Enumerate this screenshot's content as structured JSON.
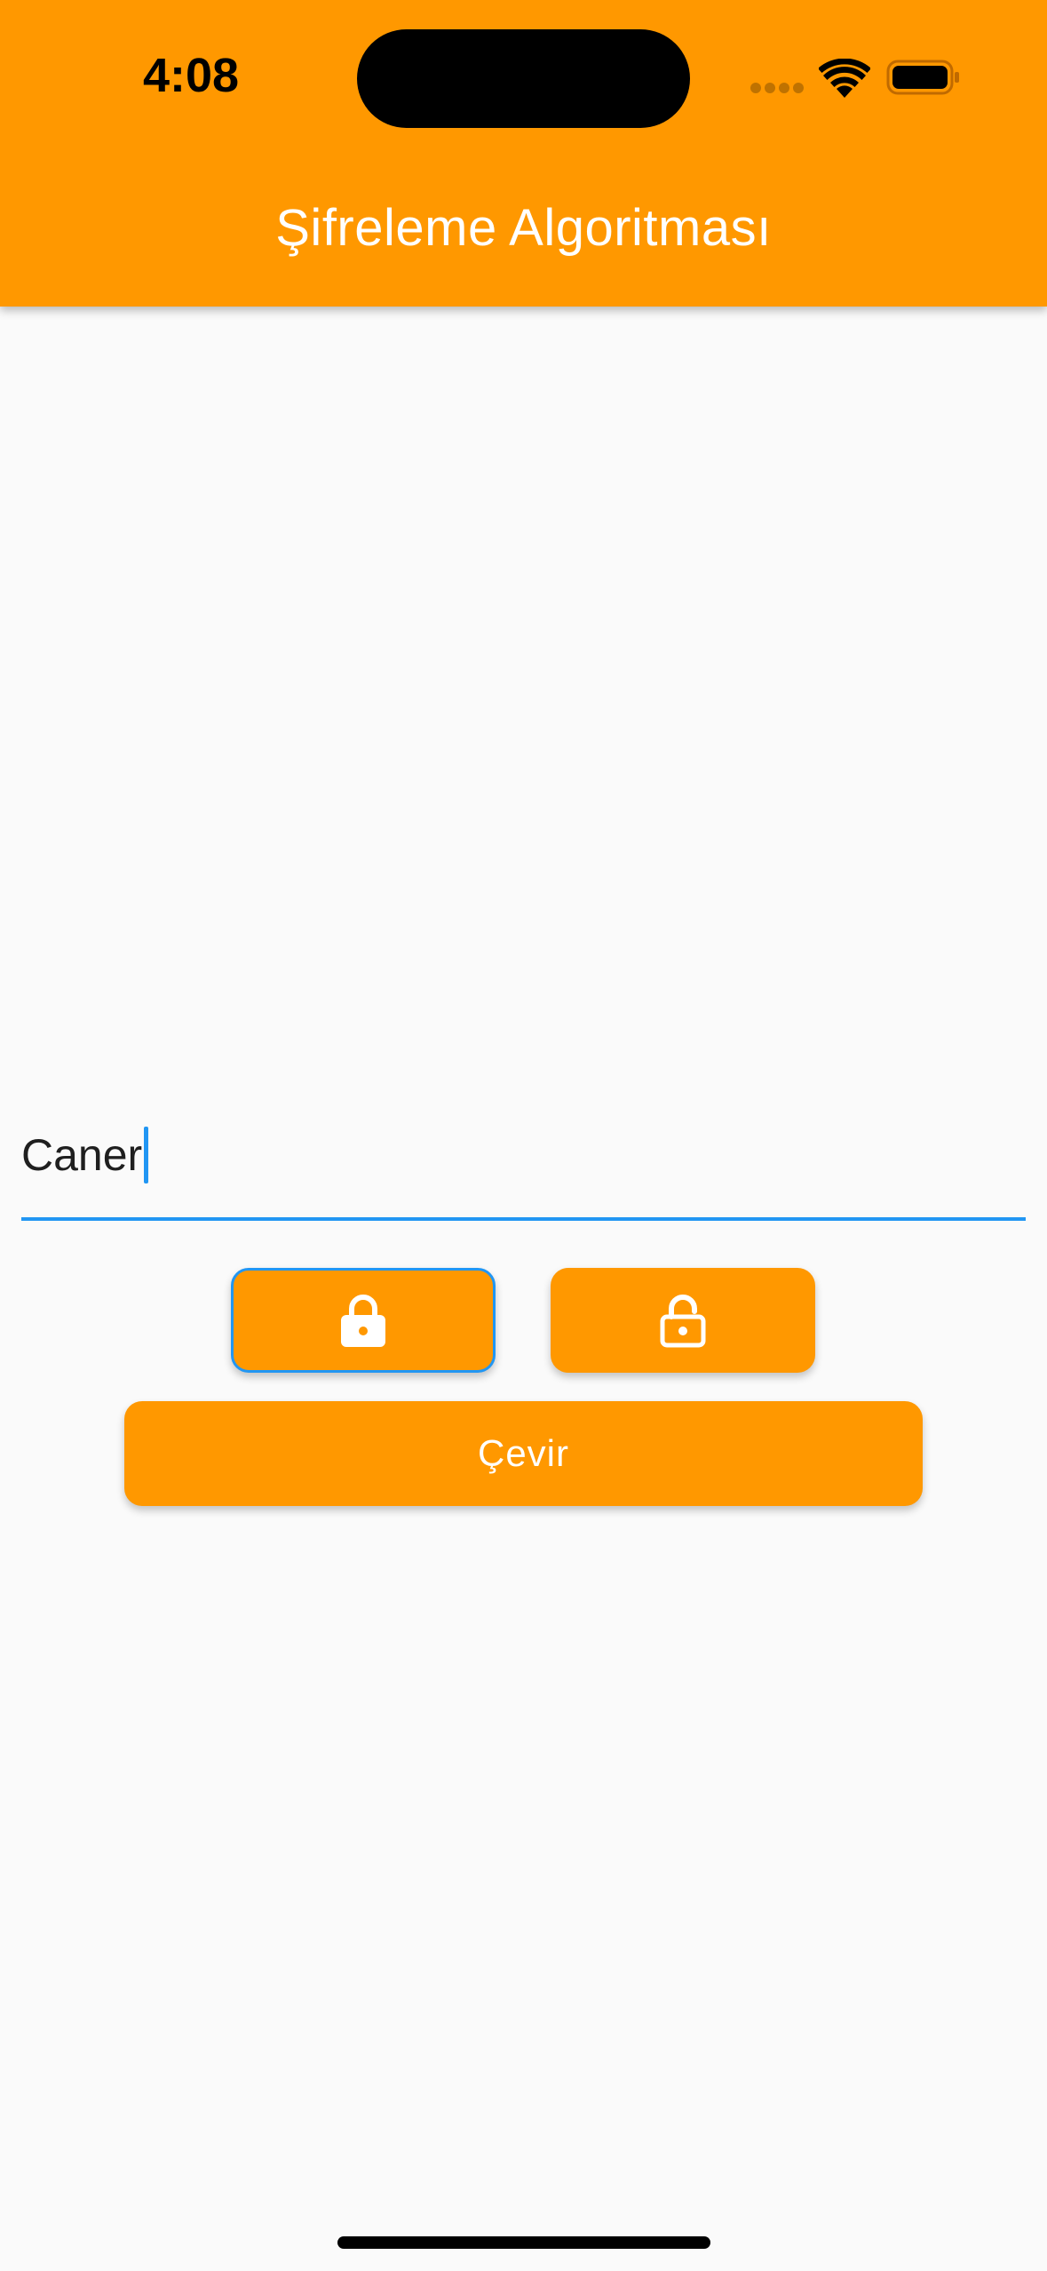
{
  "status_bar": {
    "time": "4:08"
  },
  "app_bar": {
    "title": "Şifreleme Algoritması",
    "background_color": "#ff9800"
  },
  "text_field": {
    "value": "Caner",
    "focused": true,
    "accent_color": "#2196f3"
  },
  "buttons": {
    "encrypt_icon": "lock-icon",
    "decrypt_icon": "lock-open-icon",
    "convert_label": "Çevir"
  }
}
